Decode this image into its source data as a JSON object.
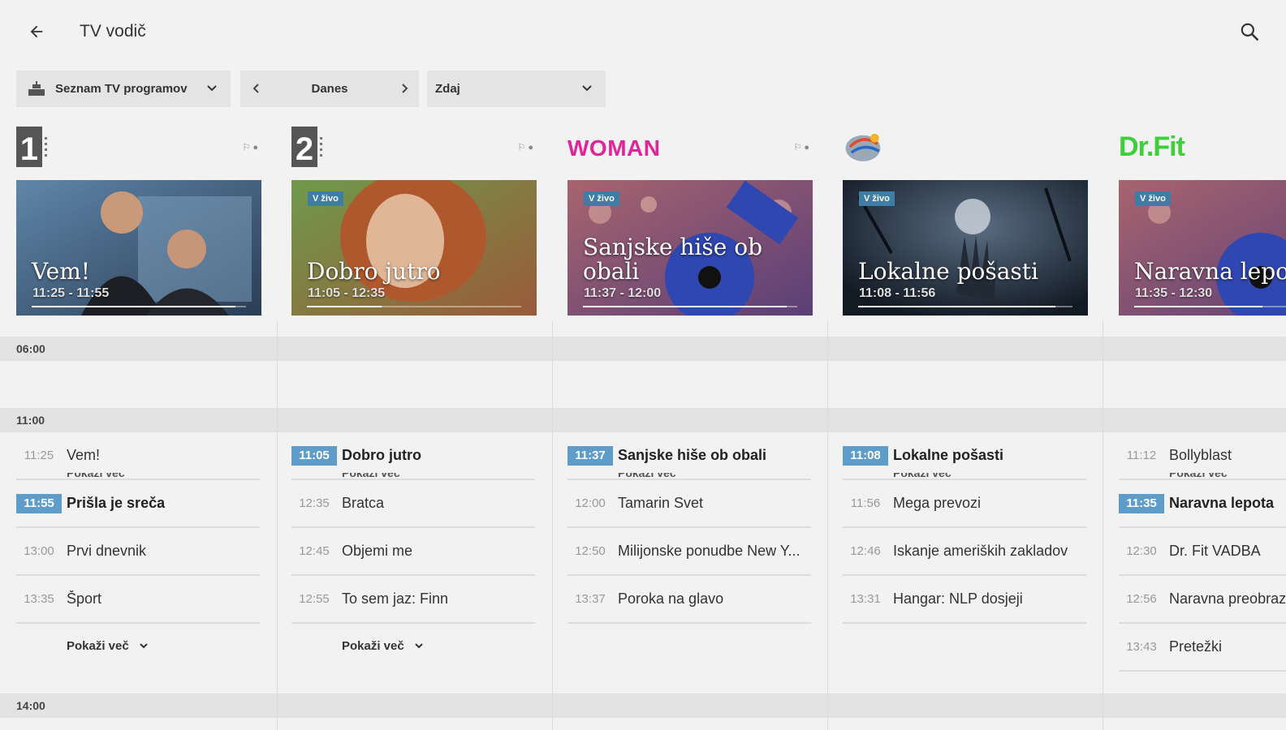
{
  "header": {
    "title": "TV vodič",
    "back_icon": "arrow-left-icon",
    "search_icon": "search-icon"
  },
  "filters": {
    "channel_list": "Seznam TV programov",
    "day": "Danes",
    "time": "Zdaj"
  },
  "bands": [
    "06:00",
    "11:00",
    "14:00"
  ],
  "show_more_label": "Pokaži več",
  "live_label": "V živo",
  "channels": [
    {
      "logo": "1",
      "card": {
        "title": "Vem!",
        "time": "11:25 - 11:55",
        "live": false,
        "progress": 0.95,
        "colors": [
          "#5f86a9",
          "#2a3d55"
        ]
      },
      "programs": [
        {
          "time": "11:25",
          "name": "Vem!",
          "now": false
        },
        {
          "time": "11:55",
          "name": "Prišla je sreča",
          "now": true
        },
        {
          "time": "13:00",
          "name": "Prvi dnevnik",
          "now": false
        },
        {
          "time": "13:35",
          "name": "Šport",
          "now": false
        }
      ],
      "has_more": true
    },
    {
      "logo": "2",
      "card": {
        "title": "Dobro jutro",
        "time": "11:05 - 12:35",
        "live": true,
        "progress": 0.35,
        "colors": [
          "#6f9a4a",
          "#9a5a3a"
        ]
      },
      "programs": [
        {
          "time": "11:05",
          "name": "Dobro jutro",
          "now": true
        },
        {
          "time": "12:35",
          "name": "Bratca",
          "now": false
        },
        {
          "time": "12:45",
          "name": "Objemi me",
          "now": false
        },
        {
          "time": "12:55",
          "name": "To sem jaz: Finn",
          "now": false
        }
      ],
      "has_more": true
    },
    {
      "logo": "WOMAN",
      "card": {
        "title": "Sanjske hiše ob obali",
        "time": "11:37 - 12:00",
        "live": true,
        "progress": 0.95,
        "colors": [
          "#9e5a6a",
          "#3a3f8a"
        ]
      },
      "programs": [
        {
          "time": "11:37",
          "name": "Sanjske hiše ob obali",
          "now": true
        },
        {
          "time": "12:00",
          "name": "Tamarin Svet",
          "now": false
        },
        {
          "time": "12:50",
          "name": "Milijonske ponudbe New Y...",
          "now": false
        },
        {
          "time": "13:37",
          "name": "Poroka na glavo",
          "now": false
        }
      ],
      "has_more": false
    },
    {
      "logo": "circle",
      "card": {
        "title": "Lokalne pošasti",
        "time": "11:08 - 11:56",
        "live": true,
        "progress": 0.92,
        "colors": [
          "#1f2a3a",
          "#3b4a5e"
        ]
      },
      "programs": [
        {
          "time": "11:08",
          "name": "Lokalne pošasti",
          "now": true
        },
        {
          "time": "11:56",
          "name": "Mega prevozi",
          "now": false
        },
        {
          "time": "12:46",
          "name": "Iskanje ameriških zakladov",
          "now": false
        },
        {
          "time": "13:31",
          "name": "Hangar: NLP dosjeji",
          "now": false
        }
      ],
      "has_more": false
    },
    {
      "logo": "Dr.Fit",
      "card": {
        "title": "Naravna lepota",
        "time": "11:35 - 12:30",
        "live": true,
        "progress": 0.6,
        "colors": [
          "#9e5a6a",
          "#3a3f8a"
        ]
      },
      "programs": [
        {
          "time": "11:12",
          "name": "Bollyblast",
          "now": false
        },
        {
          "time": "11:35",
          "name": "Naravna lepota",
          "now": true
        },
        {
          "time": "12:30",
          "name": "Dr. Fit VADBA",
          "now": false
        },
        {
          "time": "12:56",
          "name": "Naravna preobrazba",
          "now": false
        },
        {
          "time": "13:43",
          "name": "Pretežki",
          "now": false
        }
      ],
      "has_more": false
    }
  ]
}
